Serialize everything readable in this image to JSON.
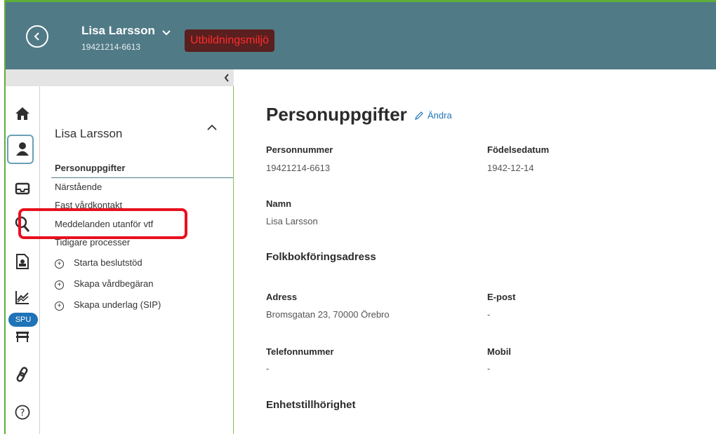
{
  "header": {
    "patient_name": "Lisa Larsson",
    "personnummer": "19421214-6613",
    "environment_badge": "Utbildningsmiljö",
    "back_icon": "chevron-left-circle-icon"
  },
  "rail": {
    "icons": [
      "home-icon",
      "patient-icon",
      "inbox-icon",
      "search-icon",
      "document-icon",
      "chart-icon",
      "spu-bed-icon",
      "link-icon",
      "help-icon"
    ],
    "spu_badge": "SPU"
  },
  "nav": {
    "title": "Lisa Larsson",
    "items": [
      {
        "label": "Personuppgifter",
        "active": true
      },
      {
        "label": "Närstående"
      },
      {
        "label": "Fast vårdkontakt"
      },
      {
        "label": "Meddelanden utanför vtf"
      },
      {
        "label": "Tidigare processer"
      }
    ],
    "actions": [
      {
        "label": "Starta beslutstöd"
      },
      {
        "label": "Skapa vårdbegäran"
      },
      {
        "label": "Skapa underlag (SIP)"
      }
    ]
  },
  "main": {
    "title": "Personuppgifter",
    "edit_label": "Ändra",
    "personnummer_label": "Personnummer",
    "personnummer_value": "19421214-6613",
    "fodelsedatum_label": "Födelsedatum",
    "fodelsedatum_value": "1942-12-14",
    "namn_label": "Namn",
    "namn_value": "Lisa Larsson",
    "folkbokforing_title": "Folkbokföringsadress",
    "adress_label": "Adress",
    "adress_value": "Bromsgatan 23, 70000 Örebro",
    "epost_label": "E-post",
    "epost_value": "-",
    "telefon_label": "Telefonnummer",
    "telefon_value": "-",
    "mobil_label": "Mobil",
    "mobil_value": "-",
    "enhet_title": "Enhetstillhörighet"
  },
  "colors": {
    "header_bg": "#507a86",
    "highlight": "#e8101e",
    "accent": "#1f73b7",
    "frame": "#5fae3a"
  }
}
